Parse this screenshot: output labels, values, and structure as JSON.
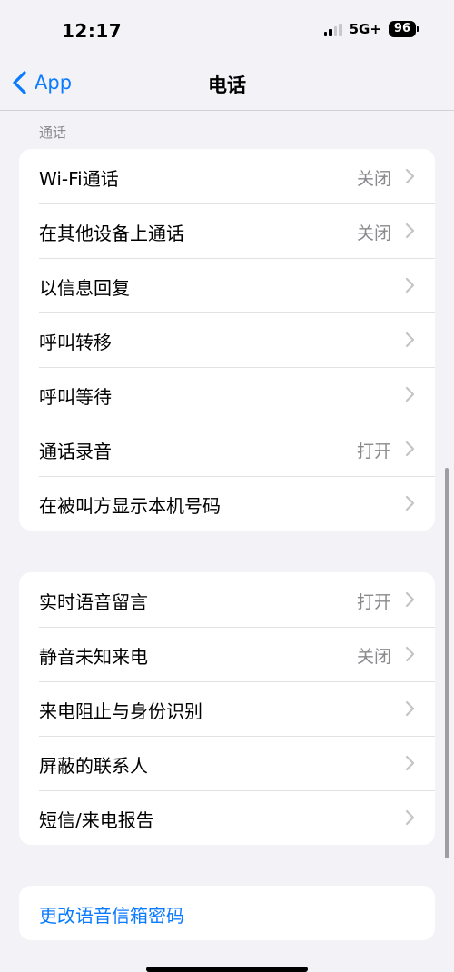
{
  "status_bar": {
    "time": "12:17",
    "network": "5G+",
    "battery": "96"
  },
  "nav": {
    "back_label": "App",
    "title": "电话"
  },
  "section_header": "通话",
  "groups": [
    {
      "rows": [
        {
          "label": "Wi-Fi通话",
          "value": "关闭"
        },
        {
          "label": "在其他设备上通话",
          "value": "关闭"
        },
        {
          "label": "以信息回复",
          "value": ""
        },
        {
          "label": "呼叫转移",
          "value": ""
        },
        {
          "label": "呼叫等待",
          "value": ""
        },
        {
          "label": "通话录音",
          "value": "打开"
        },
        {
          "label": "在被叫方显示本机号码",
          "value": ""
        }
      ]
    },
    {
      "rows": [
        {
          "label": "实时语音留言",
          "value": "打开"
        },
        {
          "label": "静音未知来电",
          "value": "关闭"
        },
        {
          "label": "来电阻止与身份识别",
          "value": ""
        },
        {
          "label": "屏蔽的联系人",
          "value": ""
        },
        {
          "label": "短信/来电报告",
          "value": ""
        }
      ]
    },
    {
      "rows": [
        {
          "label": "更改语音信箱密码"
        }
      ]
    }
  ],
  "colors": {
    "accent": "#0a7aff",
    "background": "#f2f2f7",
    "secondary_text": "#8a8a8e"
  },
  "icons": {
    "back": "chevron-left-icon",
    "row": "chevron-right-icon"
  }
}
